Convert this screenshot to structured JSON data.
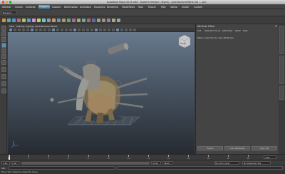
{
  "window": {
    "title": "Autodesk Maya 2014 x64 - Student Version: /Users/.../scenes/turtleTank.mb --- pCube1",
    "close_color": "#e0443e",
    "minimize_color": "#dea123",
    "zoom_color": "#1aab29"
  },
  "menubar": {
    "items": [
      {
        "label": "General",
        "active": false
      },
      {
        "label": "Curves",
        "active": false
      },
      {
        "label": "Surfaces",
        "active": false
      },
      {
        "label": "Polygons",
        "active": true
      },
      {
        "label": "Subdivs",
        "active": false
      },
      {
        "label": "Deformation",
        "active": false
      },
      {
        "label": "Animation",
        "active": false
      },
      {
        "label": "Dynamics",
        "active": false
      },
      {
        "label": "Rendering",
        "active": false
      },
      {
        "label": "PaintEffects",
        "active": false
      },
      {
        "label": "Toon",
        "active": false
      },
      {
        "label": "Muscle",
        "active": false
      },
      {
        "label": "Pipe",
        "active": false
      },
      {
        "label": "nDraw",
        "active": false
      },
      {
        "label": "nCloth",
        "active": false
      },
      {
        "label": "Custom",
        "active": false
      }
    ]
  },
  "shelf": {
    "mode": "Polygons"
  },
  "viewport": {
    "menu": [
      "View",
      "Shading",
      "Lighting",
      "Show",
      "Renderer",
      "Panels"
    ],
    "viewcube_label": "FRONT"
  },
  "attribute_editor": {
    "title": "Attribute Editor",
    "menu": [
      "List",
      "Selected",
      "Focus",
      "Attributes",
      "Show",
      "Help"
    ],
    "message": "Make a selection to view attributes.",
    "buttons": {
      "select": "Select",
      "load": "Load Attributes",
      "copy": "Copy Tab"
    },
    "side_tabs": [
      "Attribute Editor",
      "Channel Box / Layer Editor",
      "Tool Settings"
    ]
  },
  "timeslider": {
    "ticks": [
      "1",
      "2",
      "4",
      "6",
      "8",
      "10",
      "12",
      "14",
      "16",
      "18",
      "20",
      "22",
      "24"
    ],
    "current_frame": "1.00"
  },
  "rangebar": {
    "start": "1.00",
    "min": "1.00",
    "max": "24.00",
    "end": "48.00",
    "anim_layer": "No Anim Layer",
    "char_set": "No Character Set"
  },
  "cmdline": {
    "label": "MEL"
  },
  "helpline": {
    "text": "Move Tool: Select an object to move."
  }
}
